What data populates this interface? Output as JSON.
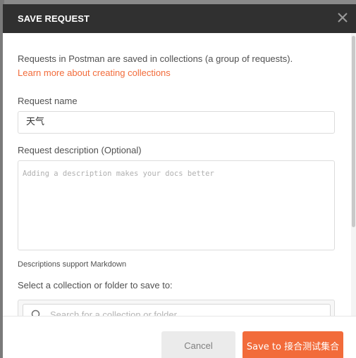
{
  "modal": {
    "title": "SAVE REQUEST"
  },
  "intro": {
    "text": "Requests in Postman are saved in collections (a group of requests).",
    "link": "Learn more about creating collections"
  },
  "request_name": {
    "label": "Request name",
    "value": "天气"
  },
  "request_description": {
    "label": "Request description (Optional)",
    "placeholder": "Adding a description makes your docs better",
    "hint": "Descriptions support Markdown"
  },
  "collection": {
    "label": "Select a collection or folder to save to:",
    "search_placeholder": "Search for a collection or folder"
  },
  "footer": {
    "cancel_label": "Cancel",
    "save_label": "Save to 接合测试集合"
  },
  "colors": {
    "accent": "#f26b3a",
    "header_bg": "#303030"
  },
  "icons": {
    "close": "close-icon",
    "search": "search-icon"
  }
}
